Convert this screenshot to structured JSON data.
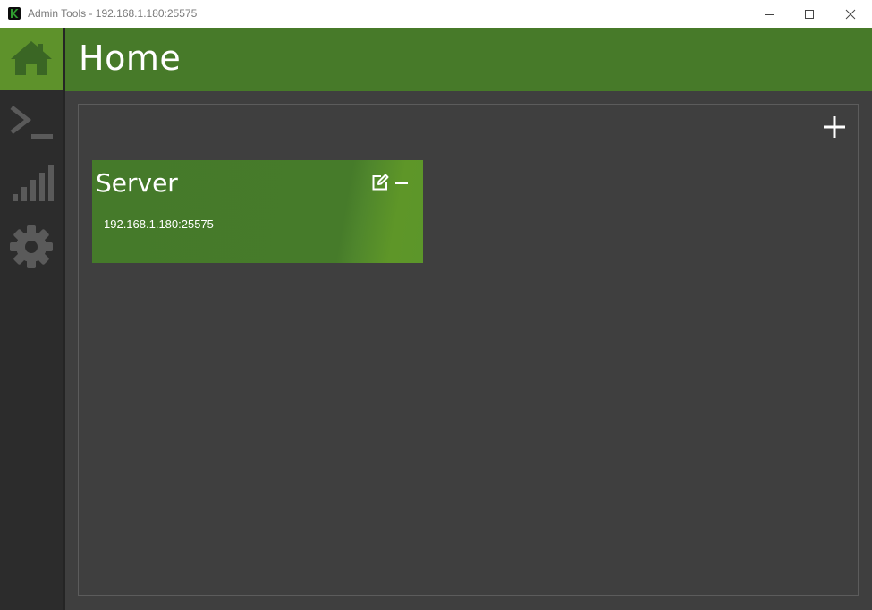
{
  "window": {
    "title": "Admin Tools - 192.168.1.180:25575",
    "icons": {
      "app": "app-logo-icon",
      "minimize": "minimize-icon",
      "maximize": "maximize-icon",
      "close": "close-icon"
    }
  },
  "sidebar": {
    "items": [
      {
        "id": "home",
        "icon": "home-icon",
        "active": true
      },
      {
        "id": "console",
        "icon": "terminal-icon",
        "active": false
      },
      {
        "id": "stats",
        "icon": "signal-bars-icon",
        "active": false
      },
      {
        "id": "settings",
        "icon": "gear-icon",
        "active": false
      }
    ]
  },
  "header": {
    "title": "Home"
  },
  "main": {
    "add_icon": "plus-icon",
    "servers": [
      {
        "name": "Server",
        "address": "192.168.1.180:25575",
        "edit_icon": "edit-icon",
        "remove_icon": "minus-icon"
      }
    ]
  },
  "colors": {
    "accent": "#477a29",
    "accent_active": "#5e922b",
    "background": "#3f3f3f",
    "sidebar": "#2c2c2c",
    "icon_inactive": "#5a5a5a"
  }
}
